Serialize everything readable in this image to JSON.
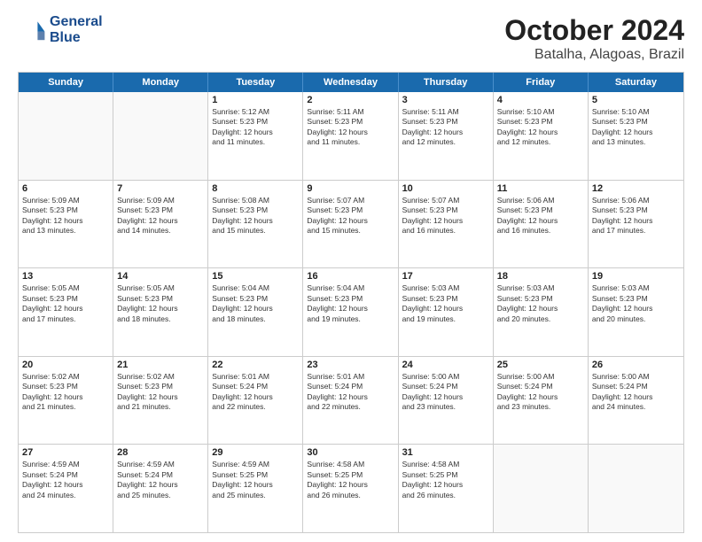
{
  "header": {
    "logo_line1": "General",
    "logo_line2": "Blue",
    "month_title": "October 2024",
    "location": "Batalha, Alagoas, Brazil"
  },
  "weekdays": [
    "Sunday",
    "Monday",
    "Tuesday",
    "Wednesday",
    "Thursday",
    "Friday",
    "Saturday"
  ],
  "weeks": [
    [
      {
        "day": "",
        "info": "",
        "empty": true
      },
      {
        "day": "",
        "info": "",
        "empty": true
      },
      {
        "day": "1",
        "info": "Sunrise: 5:12 AM\nSunset: 5:23 PM\nDaylight: 12 hours\nand 11 minutes."
      },
      {
        "day": "2",
        "info": "Sunrise: 5:11 AM\nSunset: 5:23 PM\nDaylight: 12 hours\nand 11 minutes."
      },
      {
        "day": "3",
        "info": "Sunrise: 5:11 AM\nSunset: 5:23 PM\nDaylight: 12 hours\nand 12 minutes."
      },
      {
        "day": "4",
        "info": "Sunrise: 5:10 AM\nSunset: 5:23 PM\nDaylight: 12 hours\nand 12 minutes."
      },
      {
        "day": "5",
        "info": "Sunrise: 5:10 AM\nSunset: 5:23 PM\nDaylight: 12 hours\nand 13 minutes."
      }
    ],
    [
      {
        "day": "6",
        "info": "Sunrise: 5:09 AM\nSunset: 5:23 PM\nDaylight: 12 hours\nand 13 minutes."
      },
      {
        "day": "7",
        "info": "Sunrise: 5:09 AM\nSunset: 5:23 PM\nDaylight: 12 hours\nand 14 minutes."
      },
      {
        "day": "8",
        "info": "Sunrise: 5:08 AM\nSunset: 5:23 PM\nDaylight: 12 hours\nand 15 minutes."
      },
      {
        "day": "9",
        "info": "Sunrise: 5:07 AM\nSunset: 5:23 PM\nDaylight: 12 hours\nand 15 minutes."
      },
      {
        "day": "10",
        "info": "Sunrise: 5:07 AM\nSunset: 5:23 PM\nDaylight: 12 hours\nand 16 minutes."
      },
      {
        "day": "11",
        "info": "Sunrise: 5:06 AM\nSunset: 5:23 PM\nDaylight: 12 hours\nand 16 minutes."
      },
      {
        "day": "12",
        "info": "Sunrise: 5:06 AM\nSunset: 5:23 PM\nDaylight: 12 hours\nand 17 minutes."
      }
    ],
    [
      {
        "day": "13",
        "info": "Sunrise: 5:05 AM\nSunset: 5:23 PM\nDaylight: 12 hours\nand 17 minutes."
      },
      {
        "day": "14",
        "info": "Sunrise: 5:05 AM\nSunset: 5:23 PM\nDaylight: 12 hours\nand 18 minutes."
      },
      {
        "day": "15",
        "info": "Sunrise: 5:04 AM\nSunset: 5:23 PM\nDaylight: 12 hours\nand 18 minutes."
      },
      {
        "day": "16",
        "info": "Sunrise: 5:04 AM\nSunset: 5:23 PM\nDaylight: 12 hours\nand 19 minutes."
      },
      {
        "day": "17",
        "info": "Sunrise: 5:03 AM\nSunset: 5:23 PM\nDaylight: 12 hours\nand 19 minutes."
      },
      {
        "day": "18",
        "info": "Sunrise: 5:03 AM\nSunset: 5:23 PM\nDaylight: 12 hours\nand 20 minutes."
      },
      {
        "day": "19",
        "info": "Sunrise: 5:03 AM\nSunset: 5:23 PM\nDaylight: 12 hours\nand 20 minutes."
      }
    ],
    [
      {
        "day": "20",
        "info": "Sunrise: 5:02 AM\nSunset: 5:23 PM\nDaylight: 12 hours\nand 21 minutes."
      },
      {
        "day": "21",
        "info": "Sunrise: 5:02 AM\nSunset: 5:23 PM\nDaylight: 12 hours\nand 21 minutes."
      },
      {
        "day": "22",
        "info": "Sunrise: 5:01 AM\nSunset: 5:24 PM\nDaylight: 12 hours\nand 22 minutes."
      },
      {
        "day": "23",
        "info": "Sunrise: 5:01 AM\nSunset: 5:24 PM\nDaylight: 12 hours\nand 22 minutes."
      },
      {
        "day": "24",
        "info": "Sunrise: 5:00 AM\nSunset: 5:24 PM\nDaylight: 12 hours\nand 23 minutes."
      },
      {
        "day": "25",
        "info": "Sunrise: 5:00 AM\nSunset: 5:24 PM\nDaylight: 12 hours\nand 23 minutes."
      },
      {
        "day": "26",
        "info": "Sunrise: 5:00 AM\nSunset: 5:24 PM\nDaylight: 12 hours\nand 24 minutes."
      }
    ],
    [
      {
        "day": "27",
        "info": "Sunrise: 4:59 AM\nSunset: 5:24 PM\nDaylight: 12 hours\nand 24 minutes."
      },
      {
        "day": "28",
        "info": "Sunrise: 4:59 AM\nSunset: 5:24 PM\nDaylight: 12 hours\nand 25 minutes."
      },
      {
        "day": "29",
        "info": "Sunrise: 4:59 AM\nSunset: 5:25 PM\nDaylight: 12 hours\nand 25 minutes."
      },
      {
        "day": "30",
        "info": "Sunrise: 4:58 AM\nSunset: 5:25 PM\nDaylight: 12 hours\nand 26 minutes."
      },
      {
        "day": "31",
        "info": "Sunrise: 4:58 AM\nSunset: 5:25 PM\nDaylight: 12 hours\nand 26 minutes."
      },
      {
        "day": "",
        "info": "",
        "empty": true
      },
      {
        "day": "",
        "info": "",
        "empty": true
      }
    ]
  ]
}
